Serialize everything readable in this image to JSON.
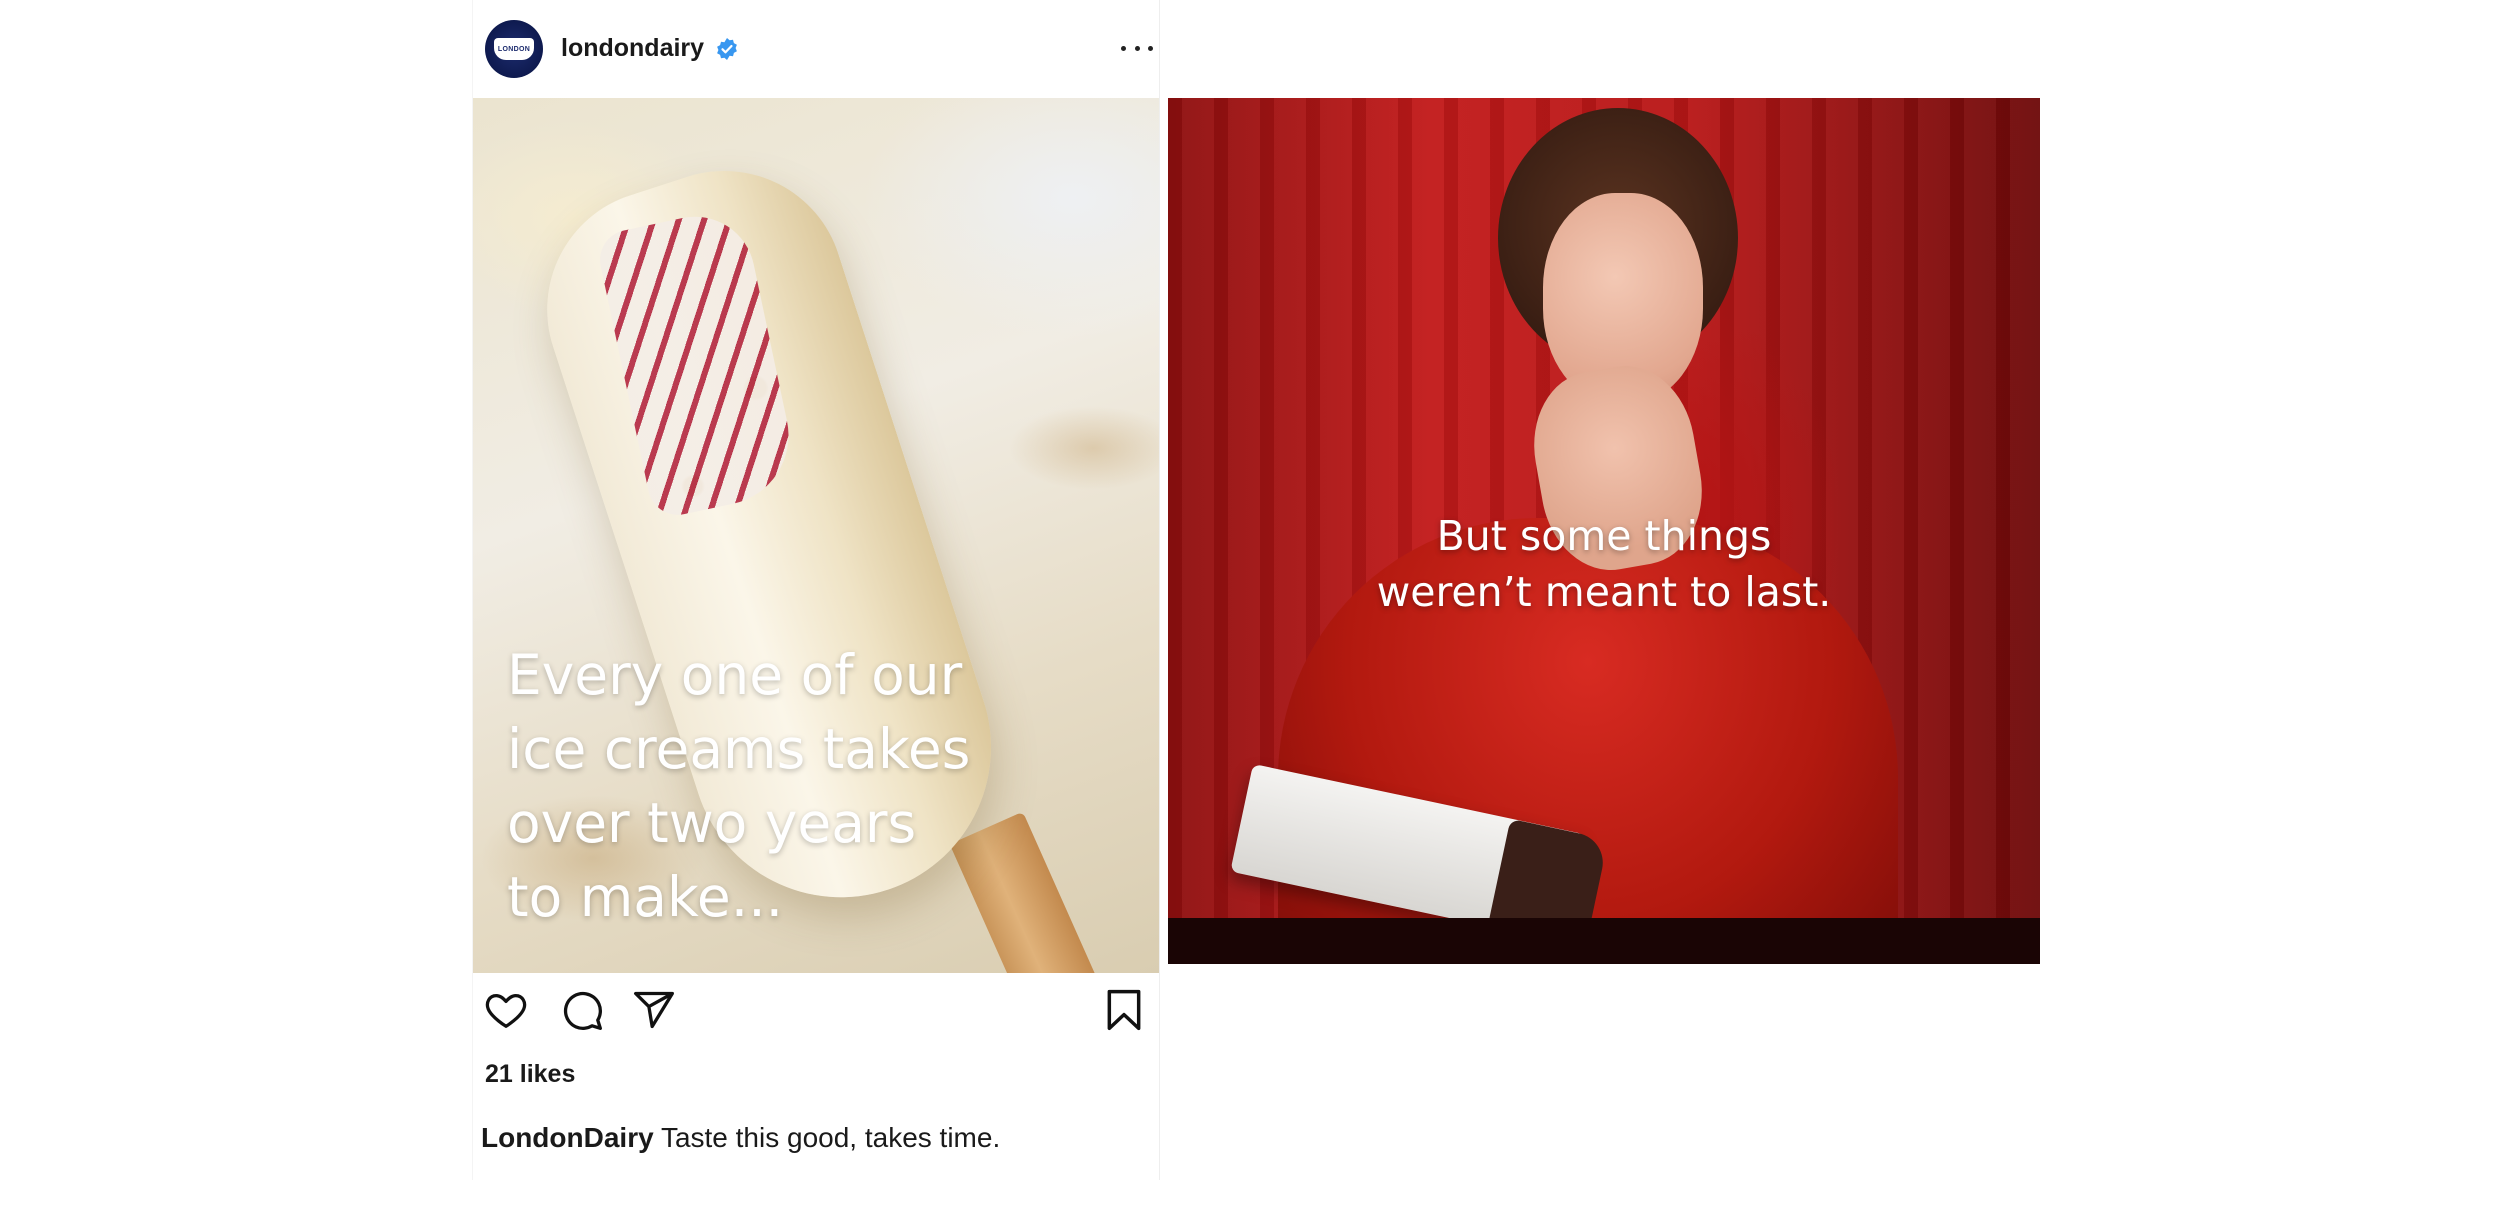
{
  "post": {
    "username": "londondairy",
    "verified": true,
    "avatar_text": "LONDON",
    "image_caption_lines": [
      "Every one of our",
      "ice creams takes",
      "over two years",
      "to make..."
    ],
    "likes": "21 likes",
    "caption_user": "LondonDairy",
    "caption_text": " Taste this good, takes time.",
    "icons": [
      "heart-icon",
      "comment-icon",
      "share-icon",
      "bookmark-icon",
      "more-options-icon"
    ]
  },
  "second_image": {
    "overlay_lines": [
      "But some things",
      "weren’t meant to last."
    ]
  },
  "colors": {
    "verified_blue": "#3897f0",
    "photo_red": "#b81717",
    "overlay_text": "#ffffff"
  }
}
